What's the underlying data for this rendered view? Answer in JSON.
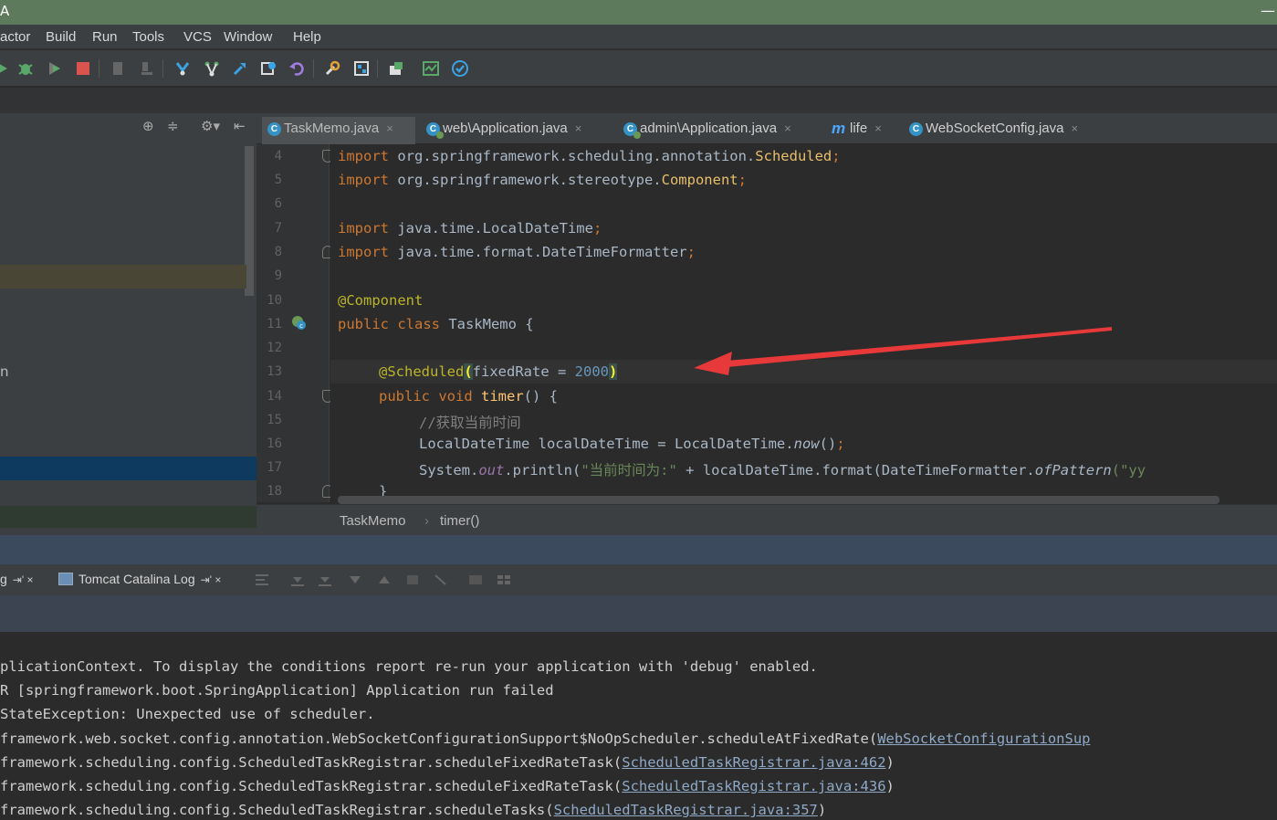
{
  "window": {
    "title": "A",
    "minimize_glyph": "—"
  },
  "menu": [
    "actor",
    "Build",
    "Run",
    "Tools",
    "VCS",
    "Window",
    "Help"
  ],
  "toolbar_icons": [
    "run-icon",
    "debug-icon",
    "coverage-icon",
    "stop-icon",
    "build-module-icon",
    "download-icon",
    "vcs-update-icon",
    "vcs-branch-icon",
    "vcs-push-icon",
    "vcs-history-icon",
    "undo-icon",
    "settings-icon",
    "structure-icon",
    "sdk-icon",
    "monitor-icon",
    "check-icon"
  ],
  "project_panel": {
    "tools": [
      "⊕",
      "≑",
      "⚙▾",
      "⇤"
    ],
    "partial_label": "n"
  },
  "tabs": [
    {
      "label": "TaskMemo.java",
      "active": true,
      "icon": "class-icon"
    },
    {
      "label": "web\\Application.java",
      "active": false,
      "icon": "spring-class-icon"
    },
    {
      "label": "admin\\Application.java",
      "active": false,
      "icon": "spring-class-icon"
    },
    {
      "label": "life",
      "active": false,
      "icon": "maven-icon"
    },
    {
      "label": "WebSocketConfig.java",
      "active": false,
      "icon": "class-icon"
    }
  ],
  "tab_close_glyph": "×",
  "editor": {
    "line_numbers": [
      "4",
      "5",
      "6",
      "7",
      "8",
      "9",
      "10",
      "11",
      "12",
      "13",
      "14",
      "15",
      "16",
      "17",
      "18"
    ],
    "lines": {
      "l4_kw": "import",
      "l4_pkg": " org.springframework.scheduling.annotation.",
      "l4_cls": "Scheduled",
      "l4_end": ";",
      "l5_kw": "import",
      "l5_pkg": " org.springframework.stereotype.",
      "l5_cls": "Component",
      "l5_end": ";",
      "l7_kw": "import",
      "l7_pkg": " java.time.LocalDateTime",
      "l7_end": ";",
      "l8_kw": "import",
      "l8_pkg": " java.time.format.DateTimeFormatter",
      "l8_end": ";",
      "l10_ann": "@Component",
      "l11_kw": "public class",
      "l11_rest": " TaskMemo {",
      "l13_ann": "@Scheduled",
      "l13_open": "(",
      "l13_param": "fixedRate = ",
      "l13_num": "2000",
      "l13_close": ")",
      "l14_kw": "public void",
      "l14_fn": " timer",
      "l14_rest": "() {",
      "l15_cmt": "//获取当前时间",
      "l16_a": "LocalDateTime localDateTime = LocalDateTime.",
      "l16_it": "now",
      "l16_b": "()",
      "l16_end": ";",
      "l17_a": "System.",
      "l17_fld": "out",
      "l17_b": ".println(",
      "l17_str": "\"当前时间为:\"",
      "l17_c": " + localDateTime.format(DateTimeFormatter.",
      "l17_it": "ofPattern",
      "l17_d": "(\"yy",
      "l18": "}"
    }
  },
  "breadcrumb": {
    "class": "TaskMemo",
    "sep": "›",
    "method": "timer()"
  },
  "run_tabs": [
    {
      "label": "g",
      "pin": "⇥' ×"
    },
    {
      "label": "Tomcat Catalina Log",
      "pin": "⇥' ×"
    }
  ],
  "console": {
    "lines": [
      {
        "text": "plicationContext. To display the conditions report re-run your application with 'debug' enabled."
      },
      {
        "text": "R [springframework.boot.SpringApplication] Application run failed"
      },
      {
        "text": "StateException: Unexpected use of scheduler."
      },
      {
        "text": "framework.web.socket.config.annotation.WebSocketConfigurationSupport$NoOpScheduler.scheduleAtFixedRate(",
        "link": "WebSocketConfigurationSup"
      },
      {
        "text": "framework.scheduling.config.ScheduledTaskRegistrar.scheduleFixedRateTask(",
        "link": "ScheduledTaskRegistrar.java:462",
        "end": ")"
      },
      {
        "text": "framework.scheduling.config.ScheduledTaskRegistrar.scheduleFixedRateTask(",
        "link": "ScheduledTaskRegistrar.java:436",
        "end": ")"
      },
      {
        "text": "framework.scheduling.config.ScheduledTaskRegistrar.scheduleTasks(",
        "link": "ScheduledTaskRegistrar.java:357",
        "end": ")"
      }
    ]
  },
  "colors": {
    "accent_arrow": "#e8393a",
    "keyword": "#cc7832",
    "annotation": "#bbb529",
    "number": "#6897bb"
  }
}
